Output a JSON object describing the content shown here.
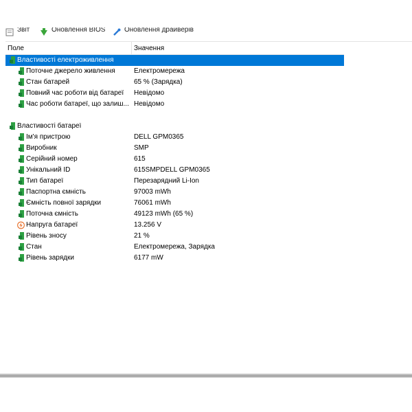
{
  "toolbar": {
    "buttons": [
      {
        "label": "Звіт",
        "icon": "report-icon"
      },
      {
        "label": "Оновлення BIOS",
        "icon": "green-arrow-icon"
      },
      {
        "label": "Оновлення драйверів",
        "icon": "driver-update-icon"
      }
    ]
  },
  "columns": {
    "field": "Поле",
    "value": "Значення"
  },
  "groups": {
    "power": {
      "title": "Властивості електроживлення",
      "rows": [
        {
          "label": "Поточне джерело живлення",
          "value": "Електромережа"
        },
        {
          "label": "Стан батарей",
          "value": "65 % (Зарядка)"
        },
        {
          "label": "Повний час роботи від батареї",
          "value": "Невідомо"
        },
        {
          "label": "Час роботи батареї, що залиш...",
          "value": "Невідомо"
        }
      ]
    },
    "battery": {
      "title": "Властивості батареї",
      "rows": [
        {
          "label": "Ім'я пристрою",
          "value": "DELL GPM0365"
        },
        {
          "label": "Виробник",
          "value": "SMP"
        },
        {
          "label": "Серійний номер",
          "value": "615"
        },
        {
          "label": "Унікальний ID",
          "value": "615SMPDELL GPM0365"
        },
        {
          "label": "Тип батареї",
          "value": "Перезарядний Li-Ion"
        },
        {
          "label": "Паспортна ємність",
          "value": "97003 mWh"
        },
        {
          "label": "Ємність повної зарядки",
          "value": "76061 mWh"
        },
        {
          "label": "Поточна ємність",
          "value": "49123 mWh  (65 %)"
        },
        {
          "label": "Напруга батареї",
          "value": "13.256 V"
        },
        {
          "label": "Рівень зносу",
          "value": "21 %"
        },
        {
          "label": "Стан",
          "value": "Електромережа, Зарядка"
        },
        {
          "label": "Рівень зарядки",
          "value": "6177 mW"
        }
      ]
    }
  },
  "colors": {
    "selection": "#0078d7",
    "battery_green": "#2ea043",
    "voltage_orange": "#e8702a"
  }
}
